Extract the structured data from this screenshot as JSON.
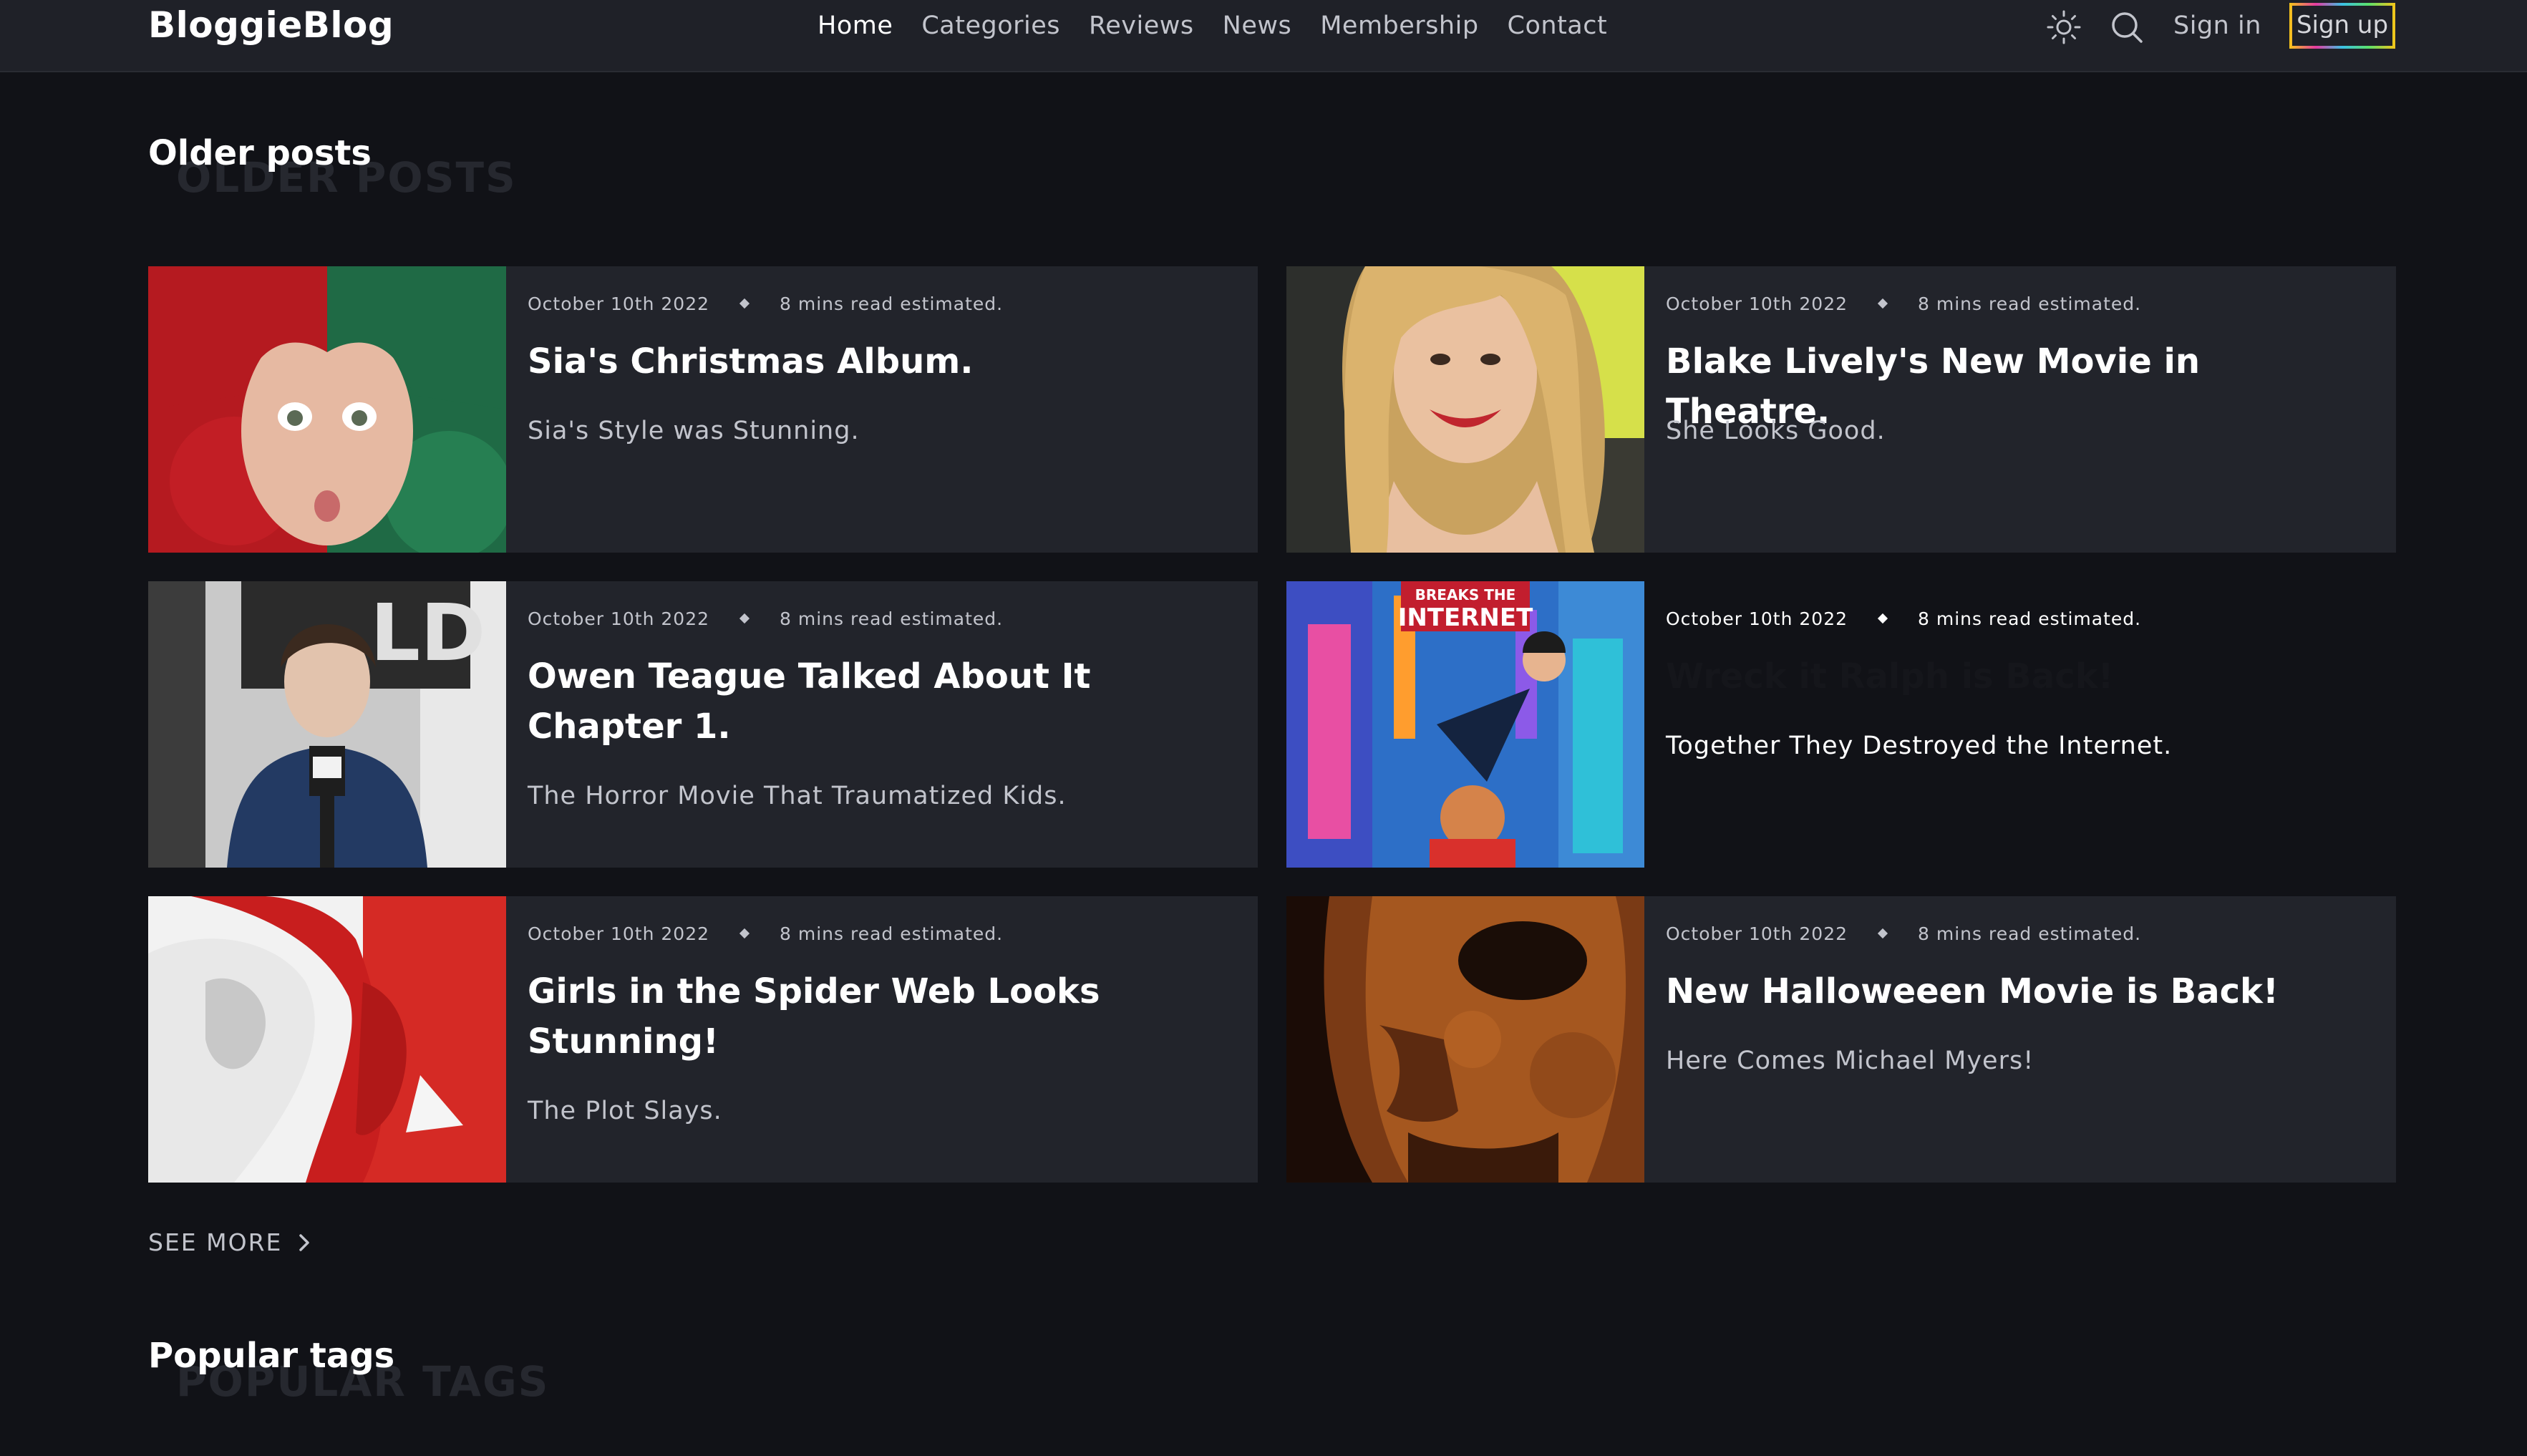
{
  "brand": "BloggieBlog",
  "nav": {
    "items": [
      {
        "label": "Home",
        "active": true
      },
      {
        "label": "Categories"
      },
      {
        "label": "Reviews"
      },
      {
        "label": "News"
      },
      {
        "label": "Membership"
      },
      {
        "label": "Contact"
      }
    ],
    "theme_icon": "sun-icon",
    "search_icon": "search-icon",
    "signin_label": "Sign in",
    "signup_label": "Sign up"
  },
  "older_posts": {
    "heading": "Older posts",
    "ghost": "OLDER POSTS",
    "posts": [
      {
        "date": "October 10th 2022",
        "read": "8 mins read estimated.",
        "title": "Sia's Christmas Album.",
        "excerpt": "Sia's Style was Stunning."
      },
      {
        "date": "October 10th 2022",
        "read": "8 mins read estimated.",
        "title": "Blake Lively's New Movie in Theatre.",
        "excerpt": "She Looks Good."
      },
      {
        "date": "October 10th 2022",
        "read": "8 mins read estimated.",
        "title": "Owen Teague Talked About It Chapter 1.",
        "excerpt": "The Horror Movie That Traumatized Kids."
      },
      {
        "date": "October 10th 2022",
        "read": "8 mins read estimated.",
        "title": "Wreck it Ralph is Back!",
        "excerpt": "Together They Destroyed the Internet."
      },
      {
        "date": "October 10th 2022",
        "read": "8 mins read estimated.",
        "title": "Girls in the Spider Web Looks Stunning!",
        "excerpt": "The Plot Slays."
      },
      {
        "date": "October 10th 2022",
        "read": "8 mins read estimated.",
        "title": "New Halloweeen Movie is Back!",
        "excerpt": "Here Comes Michael Myers!"
      }
    ],
    "see_more": "SEE MORE"
  },
  "popular_tags": {
    "heading": "Popular tags",
    "ghost": "POPULAR TAGS"
  },
  "colors": {
    "background": "#111217",
    "nav": "#1f2128",
    "card": "#22242b",
    "text": "#ffffff",
    "muted": "#c2c4cc"
  }
}
